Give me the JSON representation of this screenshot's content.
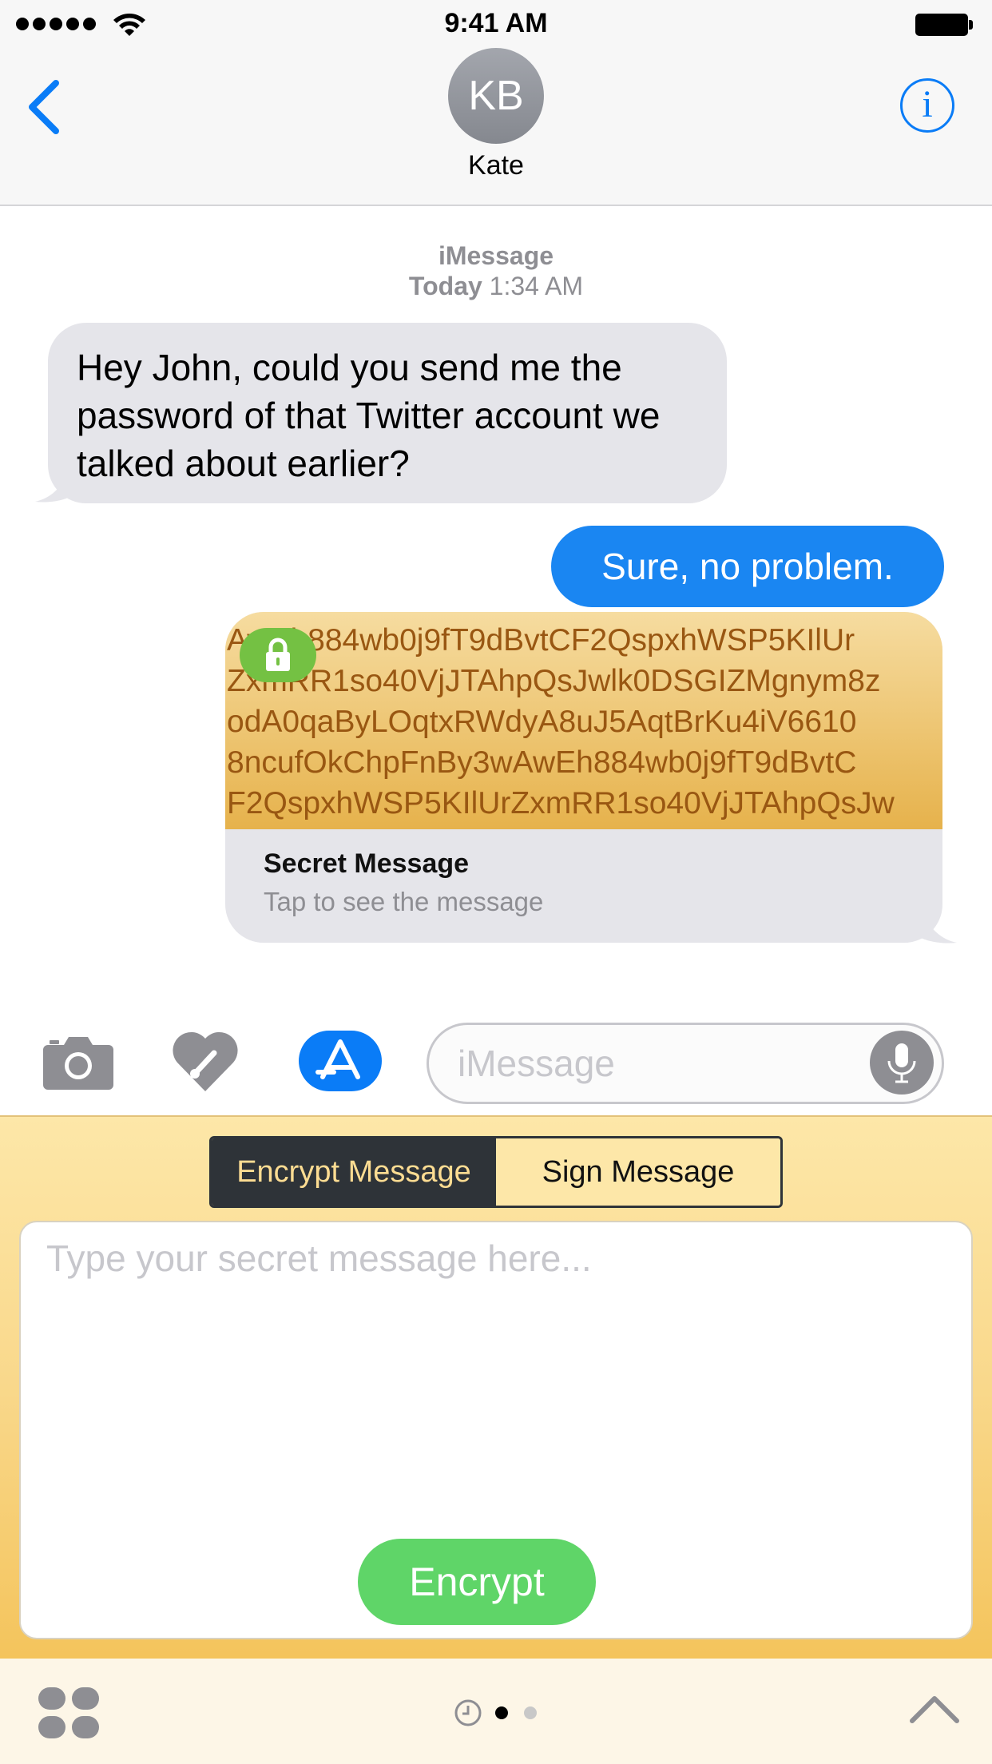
{
  "status_bar": {
    "time": "9:41 AM"
  },
  "header": {
    "avatar_initials": "KB",
    "contact_name": "Kate",
    "info_symbol": "i"
  },
  "conversation": {
    "service": "iMessage",
    "timestamp_day": "Today",
    "timestamp_time": "1:34 AM",
    "messages": [
      {
        "direction": "incoming",
        "text": "Hey John, could you send me the password of that Twitter account we talked about earlier?"
      },
      {
        "direction": "outgoing",
        "text": "Sure, no problem."
      }
    ],
    "secret_card": {
      "cipher_lines": [
        "AwEh884wb0j9fT9dBvtCF2QspxhWSP5KIlUr",
        "ZxmRR1so40VjJTAhpQsJwlk0DSGIZMgnym8z",
        "odA0qaByLOqtxRWdyA8uJ5AqtBrKu4iV6610",
        "8ncufOkChpFnBy3wAwEh884wb0j9fT9dBvtC",
        "F2QspxhWSP5KIlUrZxmRR1so40VjJTAhpQsJw"
      ],
      "title": "Secret Message",
      "subtitle": "Tap to see the message"
    }
  },
  "input_bar": {
    "placeholder": "iMessage"
  },
  "app_drawer": {
    "segments": [
      "Encrypt Message",
      "Sign Message"
    ],
    "selected_segment": "Encrypt Message",
    "secret_placeholder": "Type your secret message here...",
    "encrypt_label": "Encrypt"
  },
  "colors": {
    "ios_blue": "#0a7cf7",
    "outgoing_bubble": "#1a86f2",
    "incoming_bubble": "#e5e5ea",
    "encrypt_green": "#5fd568",
    "lock_green": "#74c143",
    "drawer_gold": "#f9d88b"
  },
  "icons": [
    "back-chevron",
    "info",
    "lock",
    "camera",
    "digital-touch-heart",
    "app-store",
    "microphone",
    "apps-grid",
    "recents-clock",
    "chevron-up"
  ]
}
